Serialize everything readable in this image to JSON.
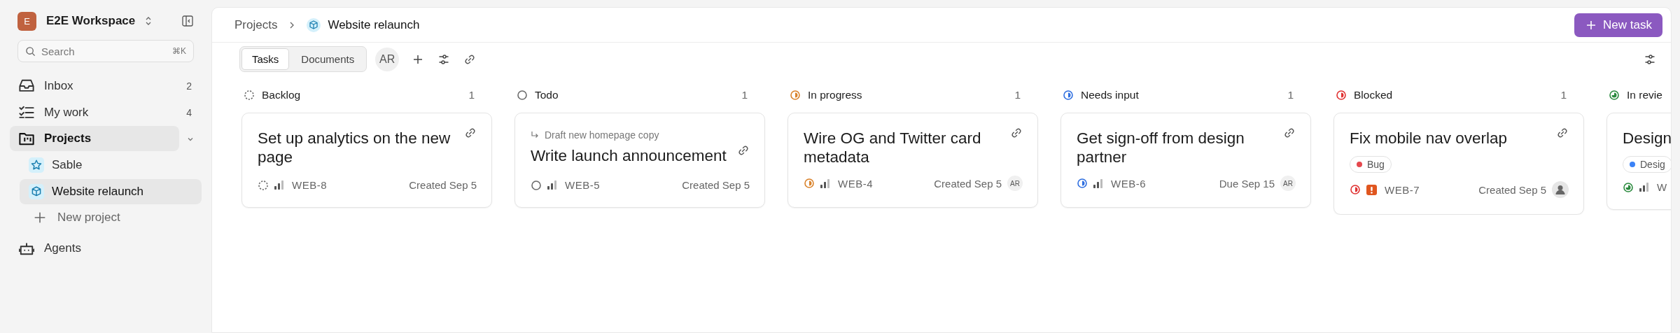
{
  "sidebar": {
    "workspace": {
      "initial": "E",
      "name": "E2E Workspace"
    },
    "search": {
      "placeholder": "Search",
      "shortcut": "⌘K"
    },
    "items": [
      {
        "label": "Inbox",
        "count": "2",
        "selected": false
      },
      {
        "label": "My work",
        "count": "4",
        "selected": false
      },
      {
        "label": "Projects",
        "selected": true,
        "expanded": true,
        "children": [
          {
            "label": "Sable",
            "selected": false
          },
          {
            "label": "Website relaunch",
            "selected": true
          }
        ]
      },
      {
        "label": "New project",
        "kind": "action",
        "selected": false
      },
      {
        "label": "Agents",
        "selected": false
      }
    ]
  },
  "header": {
    "breadcrumb": [
      "Projects",
      "Website relaunch"
    ],
    "new_task": "New task"
  },
  "tabs": [
    {
      "label": "Tasks",
      "selected": true
    },
    {
      "label": "Documents",
      "selected": false
    }
  ],
  "toolbar": {
    "avatar": "AR"
  },
  "columns": [
    {
      "name": "Backlog",
      "kind": "backlog",
      "count": "1",
      "cards": [
        {
          "title": "Set up analytics on the new page",
          "priority": {
            "kind": "medium"
          },
          "id": "WEB-8",
          "date": "Created Sep 5",
          "link": true
        }
      ]
    },
    {
      "name": "Todo",
      "kind": "todo",
      "count": "1",
      "cards": [
        {
          "parent": "Draft new homepage copy",
          "title": "Write launch announcement",
          "priority": {
            "kind": "medium"
          },
          "id": "WEB-5",
          "date": "Created Sep 5",
          "link": true
        }
      ]
    },
    {
      "name": "In progress",
      "kind": "in_progress",
      "count": "1",
      "cards": [
        {
          "title": "Wire OG and Twitter card metadata",
          "priority": {
            "kind": "medium"
          },
          "id": "WEB-4",
          "date": "Created Sep 5",
          "avatar": {
            "kind": "initials",
            "text": "AR"
          },
          "link": true
        }
      ]
    },
    {
      "name": "Needs input",
      "kind": "needs_input",
      "count": "1",
      "cards": [
        {
          "title": "Get sign-off from design partner",
          "priority": {
            "kind": "medium"
          },
          "id": "WEB-6",
          "date": "Due Sep 15",
          "avatar": {
            "kind": "initials",
            "text": "AR"
          },
          "link": true
        }
      ]
    },
    {
      "name": "Blocked",
      "kind": "blocked",
      "count": "1",
      "cards": [
        {
          "title": "Fix mobile nav overlap",
          "tags": [
            {
              "label": "Bug",
              "color": "#e5484d"
            }
          ],
          "priority": {
            "kind": "urgent"
          },
          "id": "WEB-7",
          "date": "Created Sep 5",
          "avatar": {
            "kind": "picture"
          },
          "link": true
        }
      ]
    },
    {
      "name": "In revie",
      "kind": "in_review",
      "cards": [
        {
          "title": "Design",
          "tags": [
            {
              "label": "Desig",
              "color": "#3b82f6"
            }
          ],
          "priority": {
            "kind": "medium"
          },
          "id": "W"
        }
      ]
    }
  ]
}
